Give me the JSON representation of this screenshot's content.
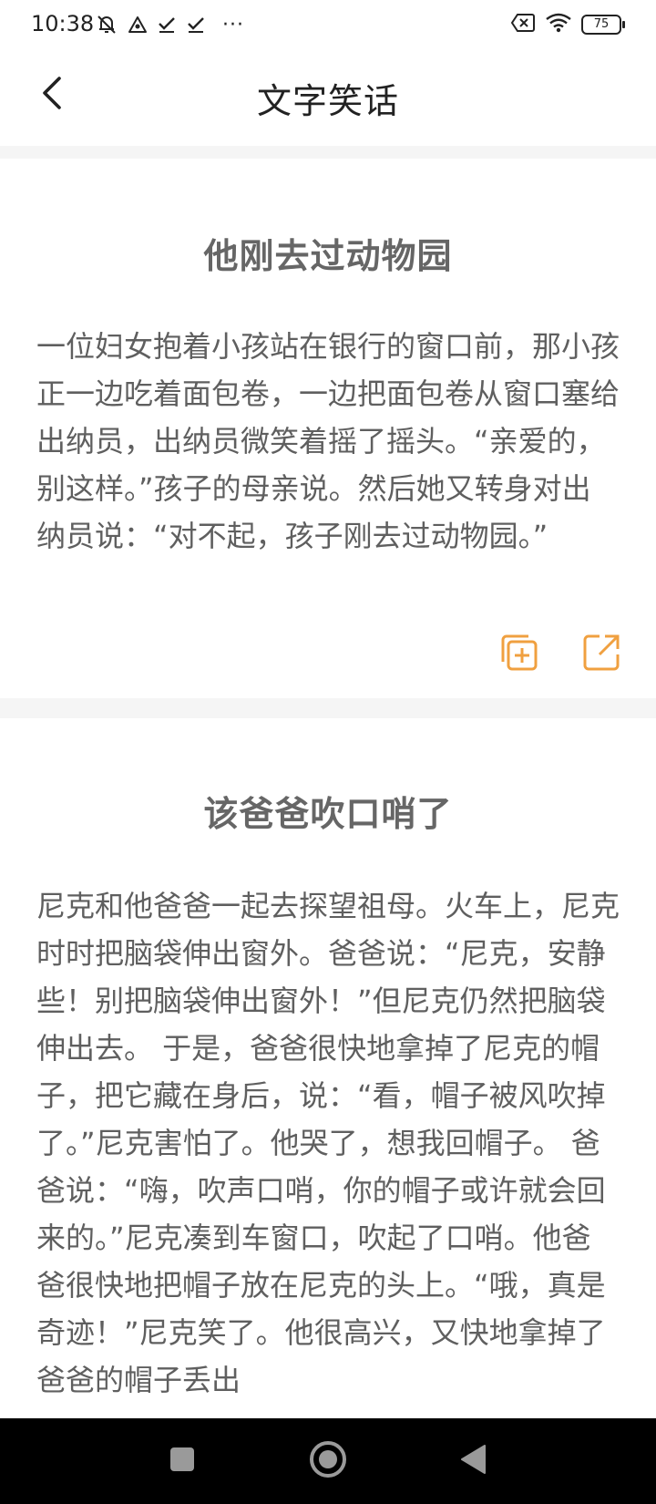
{
  "status_bar": {
    "time": "10:38",
    "more": "···",
    "battery": "75",
    "icons": [
      "mute-bell-icon",
      "triangle-icon",
      "check-icon",
      "check-icon",
      "more-icon",
      "sim-off-icon",
      "wifi-icon",
      "battery-icon"
    ]
  },
  "nav": {
    "title": "文字笑话",
    "back_icon": "chevron-left-icon"
  },
  "jokes": [
    {
      "title": "他刚去过动物园",
      "body": "一位妇女抱着小孩站在银行的窗口前，那小孩正一边吃着面包卷，一边把面包卷从窗口塞给出纳员，出纳员微笑着摇了摇头。“亲爱的，别这样。”孩子的母亲说。然后她又转身对出纳员说：“对不起，孩子刚去过动物园。”",
      "actions": [
        "copy-add-icon",
        "share-icon"
      ]
    },
    {
      "title": "该爸爸吹口哨了",
      "body": "尼克和他爸爸一起去探望祖母。火车上，尼克时时把脑袋伸出窗外。爸爸说：“尼克，安静些！别把脑袋伸出窗外！”但尼克仍然把脑袋伸出去。 于是，爸爸很快地拿掉了尼克的帽子，把它藏在身后，说：“看，帽子被风吹掉了。”尼克害怕了。他哭了，想我回帽子。 爸爸说：“嗨，吹声口哨，你的帽子或许就会回来的。”尼克凑到车窗口，吹起了口哨。他爸爸很快地把帽子放在尼克的头上。“哦，真是奇迹！”尼克笑了。他很高兴，又快地拿掉了爸爸的帽子丢出"
    }
  ],
  "colors": {
    "accent": "#f0a040",
    "text_body": "#5f5f5f",
    "title_gray": "#666666",
    "divider": "#f5f5f5"
  },
  "system_nav": [
    "recents-square-icon",
    "home-circle-icon",
    "back-triangle-icon"
  ]
}
